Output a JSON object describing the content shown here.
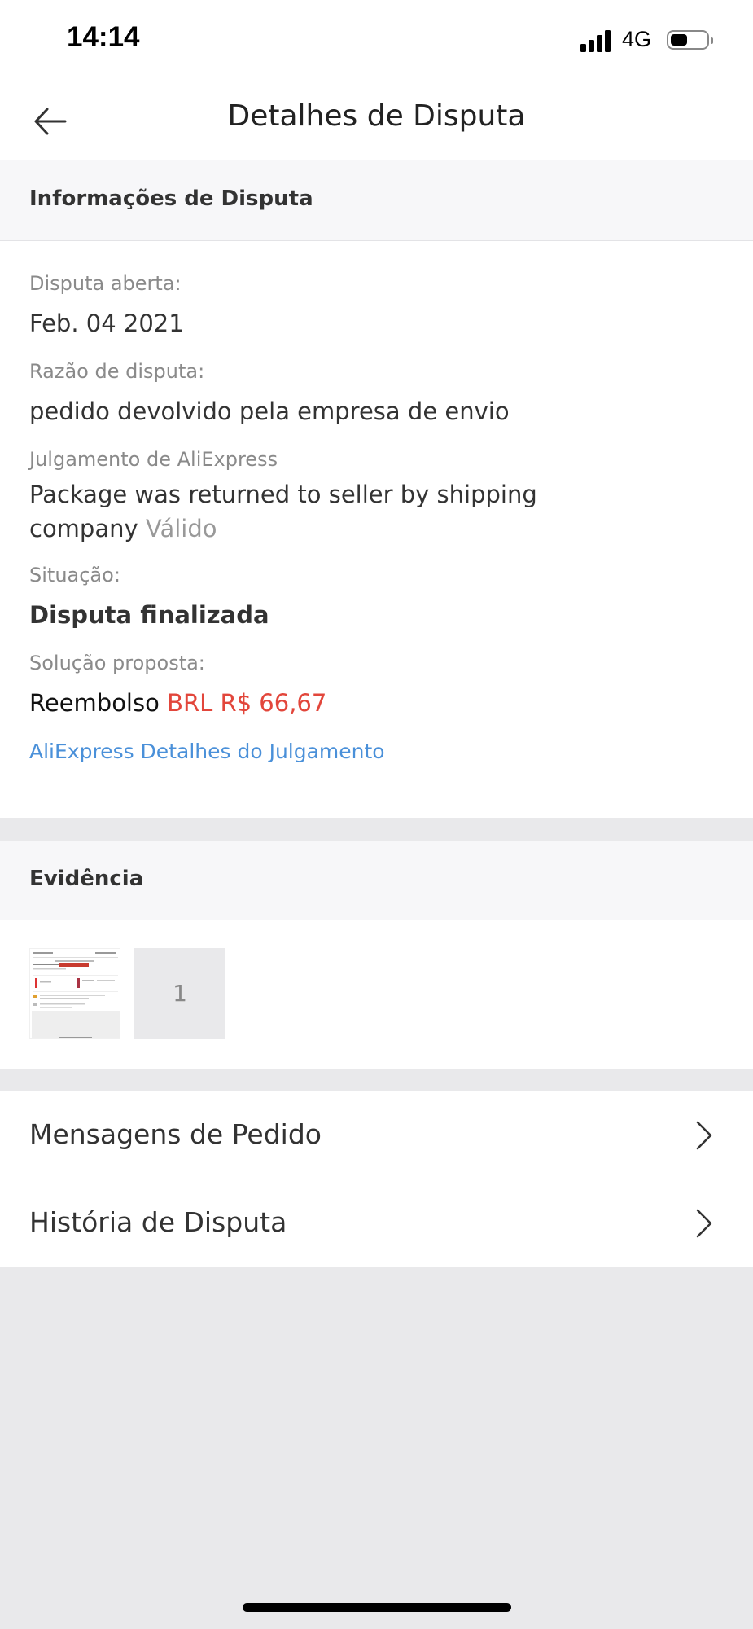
{
  "status_bar": {
    "time": "14:14",
    "network": "4G",
    "battery_level": 0.45,
    "signal_bars": 4
  },
  "header": {
    "title": "Detalhes de Disputa",
    "back_icon": "arrow-left-icon"
  },
  "dispute_info": {
    "section_title": "Informações de Disputa",
    "opened_label": "Disputa aberta:",
    "opened_value": "Feb. 04 2021",
    "reason_label": "Razão de disputa:",
    "reason_value": "pedido devolvido pela empresa de envio",
    "judgment_label": "Julgamento de AliExpress",
    "judgment_value": "Package was returned to seller by shipping company",
    "judgment_validity": "Válido",
    "status_label": "Situação:",
    "status_value": "Disputa finalizada",
    "solution_label": "Solução proposta:",
    "solution_type": "Reembolso",
    "solution_amount": "BRL R$ 66,67",
    "details_link": "AliExpress Detalhes do Julgamento"
  },
  "evidence": {
    "section_title": "Evidência",
    "count": "1"
  },
  "menu": {
    "items": [
      {
        "label": "Mensagens de Pedido"
      },
      {
        "label": "História de Disputa"
      }
    ]
  },
  "colors": {
    "accent_link": "#4a90d9",
    "amount_red": "#e2463b",
    "page_bg": "#e9e9eb"
  }
}
